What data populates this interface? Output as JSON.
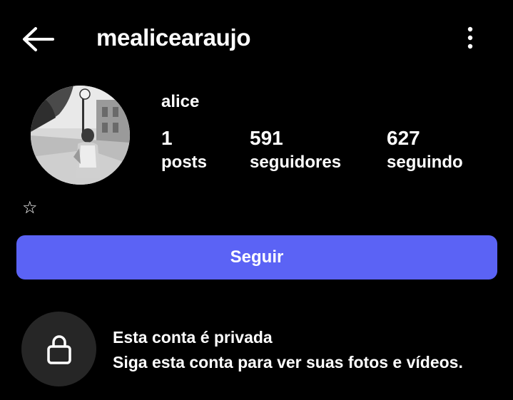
{
  "header": {
    "username": "mealicearaujo",
    "back_icon": "arrow-left-icon",
    "more_icon": "more-vertical-icon"
  },
  "profile": {
    "display_name": "alice",
    "avatar_icon": "profile-photo",
    "stats": [
      {
        "number": "1",
        "label": "posts"
      },
      {
        "number": "591",
        "label": "seguidores"
      },
      {
        "number": "627",
        "label": "seguindo"
      }
    ],
    "bio": "☆"
  },
  "follow_button": {
    "label": "Seguir",
    "color": "#5b63f5"
  },
  "private_notice": {
    "icon": "lock-icon",
    "title": "Esta conta é privada",
    "subtitle": "Siga esta conta para ver suas fotos e vídeos."
  }
}
